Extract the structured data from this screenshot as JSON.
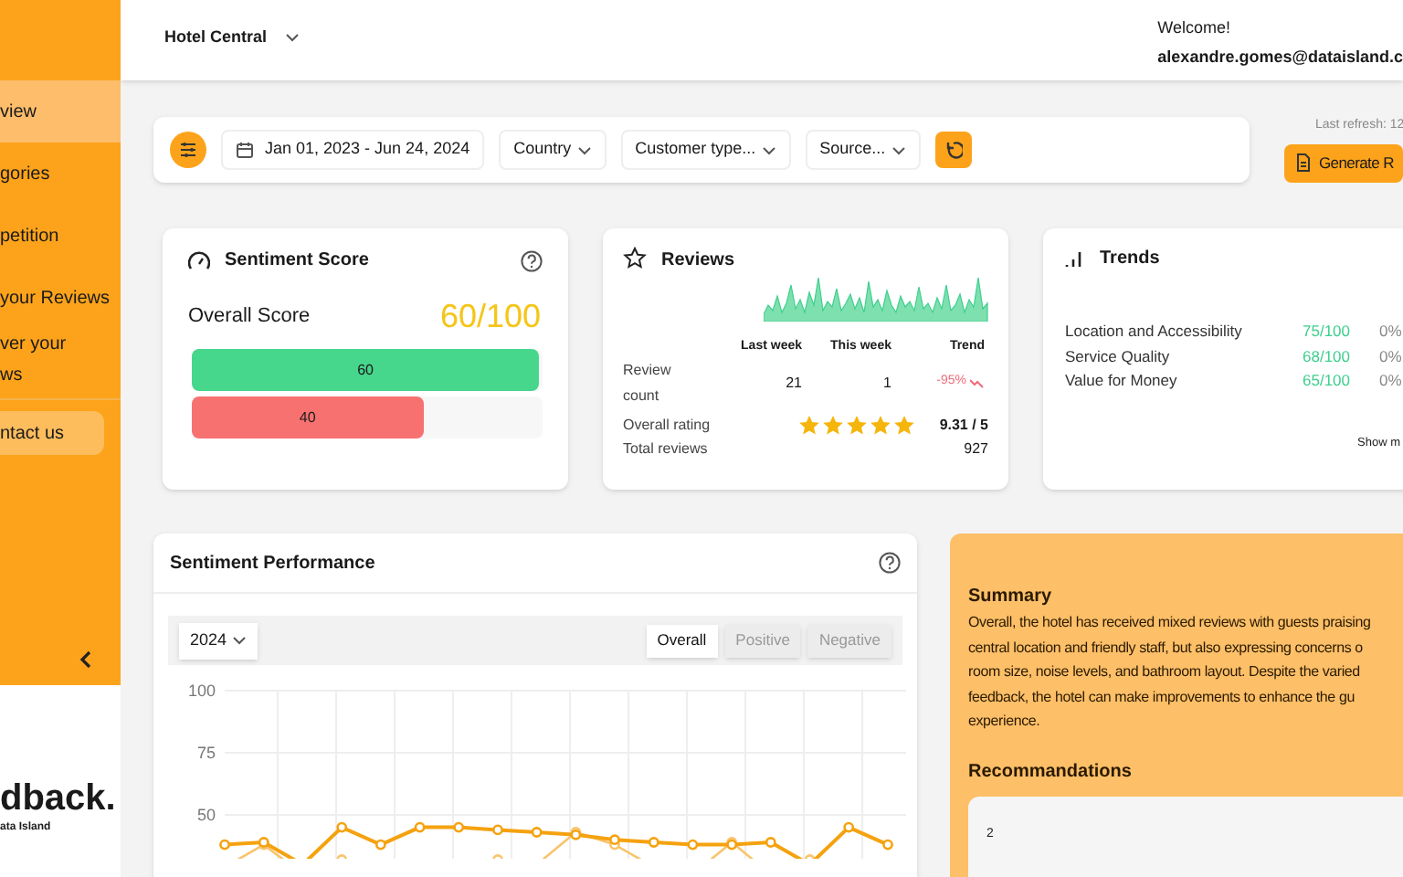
{
  "sidebar": {
    "items": [
      {
        "label": "view",
        "selected": true
      },
      {
        "label": "gories",
        "selected": false
      },
      {
        "label": "petition",
        "selected": false
      },
      {
        "label": "your Reviews",
        "selected": false
      },
      {
        "label": "ver your\nws",
        "selected": false
      }
    ],
    "contact": "ntact us",
    "logo": "dback.",
    "logo_sub": "ata Island"
  },
  "header": {
    "hotel": "Hotel Central",
    "welcome": "Welcome!",
    "email": "alexandre.gomes@dataisland.c"
  },
  "filters": {
    "date": "Jan 01, 2023 - Jun 24, 2024",
    "dropdowns": [
      "Country",
      "Customer type...",
      "Source..."
    ]
  },
  "last_refresh": "Last refresh: 12",
  "generate_button": "Generate R",
  "sentiment": {
    "title": "Sentiment Score",
    "overall_label": "Overall Score",
    "overall_value": "60/100",
    "bars": [
      {
        "label": "60",
        "level": 0.99,
        "color": "#46d68c"
      },
      {
        "label": "40",
        "level": 0.66,
        "color": "#f87171"
      }
    ]
  },
  "reviews": {
    "title": "Reviews",
    "columns": [
      "Last week",
      "This week",
      "Trend"
    ],
    "review_count_label": "Review\ncount",
    "last_week": "21",
    "this_week": "1",
    "trend": "-95%",
    "rating_label": "Overall rating",
    "stars": 5,
    "rating": "9.31 / 5",
    "total_label": "Total reviews",
    "total": "927"
  },
  "trends": {
    "title": "Trends",
    "rows": [
      {
        "label": "Location and Accessibility",
        "score": "75/100",
        "change": "0%"
      },
      {
        "label": "Service Quality",
        "score": "68/100",
        "change": "0%"
      },
      {
        "label": "Value for Money",
        "score": "65/100",
        "change": "0%"
      }
    ],
    "show_more": "Show m"
  },
  "performance": {
    "title": "Sentiment Performance",
    "year": "2024",
    "tabs": [
      {
        "label": "Overall",
        "selected": true
      },
      {
        "label": "Positive",
        "selected": false
      },
      {
        "label": "Negative",
        "selected": false
      }
    ],
    "y_axis_labels": [
      "100",
      "75",
      "50"
    ]
  },
  "summary": {
    "title": "Summary",
    "text": "Overall, the hotel has received mixed reviews with guests praising\ncentral location and friendly staff, but also expressing concerns o\nroom size, noise levels, and bathroom layout. Despite the varied\nfeedback, the hotel can make improvements to enhance the gu\nexperience.",
    "recommendations_title": "Recommandations",
    "recommendations_text": "2"
  }
}
